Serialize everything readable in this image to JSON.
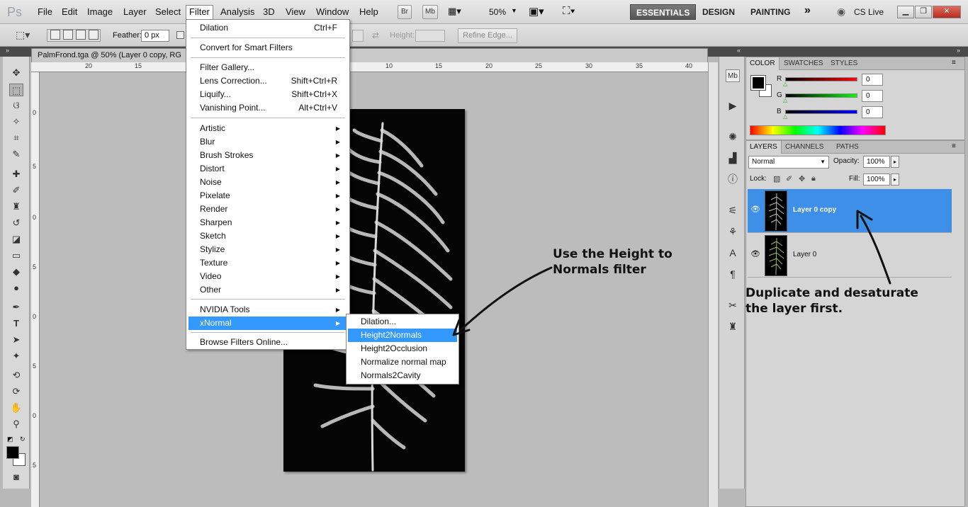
{
  "menu": {
    "logo": "Ps",
    "items": [
      "File",
      "Edit",
      "Image",
      "Layer",
      "Select",
      "Filter",
      "Analysis",
      "3D",
      "View",
      "Window",
      "Help"
    ],
    "bridge": "Br",
    "minibridge": "Mb",
    "zoom": "50%",
    "workspaces": [
      "ESSENTIALS",
      "DESIGN",
      "PAINTING"
    ],
    "more": "»",
    "cslive": "CS Live"
  },
  "options": {
    "feather_label": "Feather:",
    "feather_value": "0 px",
    "height_label": "Height:",
    "refine_edge": "Refine Edge..."
  },
  "document": {
    "tab_title": "PalmFrond.tga @ 50% (Layer 0 copy, RG",
    "ruler_top": [
      "20",
      "15",
      "10",
      "15",
      "20",
      "25",
      "30",
      "35",
      "40"
    ],
    "ruler_left": [
      "0",
      "5",
      "0",
      "5",
      "0",
      "5",
      "0",
      "5"
    ]
  },
  "filter_menu": {
    "items": [
      {
        "label": "Dilation",
        "shortcut": "Ctrl+F"
      },
      {
        "label": "Convert for Smart Filters"
      },
      {
        "label": "Filter Gallery..."
      },
      {
        "label": "Lens Correction...",
        "shortcut": "Shift+Ctrl+R"
      },
      {
        "label": "Liquify...",
        "shortcut": "Shift+Ctrl+X"
      },
      {
        "label": "Vanishing Point...",
        "shortcut": "Alt+Ctrl+V"
      },
      {
        "label": "Artistic"
      },
      {
        "label": "Blur"
      },
      {
        "label": "Brush Strokes"
      },
      {
        "label": "Distort"
      },
      {
        "label": "Noise"
      },
      {
        "label": "Pixelate"
      },
      {
        "label": "Render"
      },
      {
        "label": "Sharpen"
      },
      {
        "label": "Sketch"
      },
      {
        "label": "Stylize"
      },
      {
        "label": "Texture"
      },
      {
        "label": "Video"
      },
      {
        "label": "Other"
      },
      {
        "label": "NVIDIA Tools"
      },
      {
        "label": "xNormal"
      },
      {
        "label": "Browse Filters Online..."
      }
    ]
  },
  "xnormal_submenu": [
    "Dilation...",
    "Height2Normals",
    "Height2Occlusion",
    "Normalize normal map",
    "Normals2Cavity"
  ],
  "color_panel": {
    "tabs": [
      "COLOR",
      "SWATCHES",
      "STYLES"
    ],
    "r_label": "R",
    "r_value": "0",
    "g_label": "G",
    "g_value": "0",
    "b_label": "B",
    "b_value": "0"
  },
  "layers_panel": {
    "tabs": [
      "LAYERS",
      "CHANNELS",
      "PATHS"
    ],
    "blend_mode": "Normal",
    "opacity_label": "Opacity:",
    "opacity_value": "100%",
    "lock_label": "Lock:",
    "fill_label": "Fill:",
    "fill_value": "100%",
    "layers": [
      {
        "name": "Layer 0 copy",
        "selected": true
      },
      {
        "name": "Layer 0",
        "selected": false
      }
    ]
  },
  "annotations": {
    "filter_note_1": "Use the Height to",
    "filter_note_2": "Normals filter",
    "layer_note_1": "Duplicate and desaturate",
    "layer_note_2": "the layer first."
  },
  "colors": {
    "highlight": "#3399ff",
    "selected_layer": "#3d8fe8",
    "active_workspace": "#555555"
  }
}
